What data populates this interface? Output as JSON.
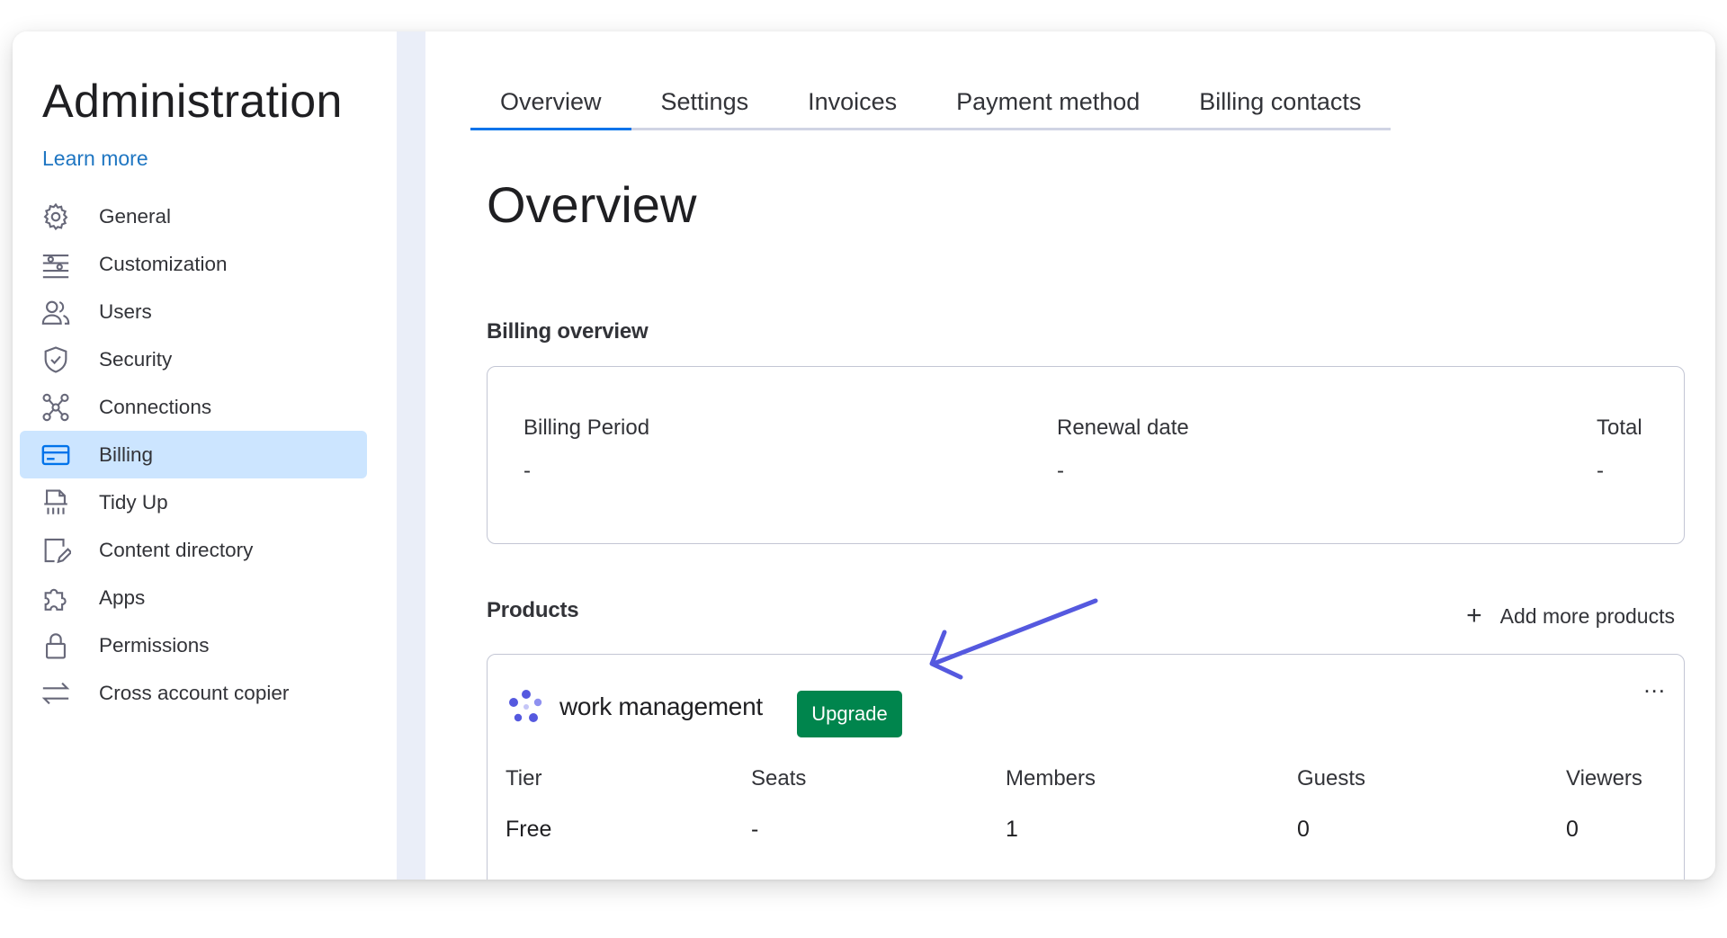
{
  "sidebar": {
    "title": "Administration",
    "learn_more": "Learn more",
    "items": [
      {
        "label": "General",
        "icon": "gear-icon"
      },
      {
        "label": "Customization",
        "icon": "sliders-icon"
      },
      {
        "label": "Users",
        "icon": "users-icon"
      },
      {
        "label": "Security",
        "icon": "shield-icon"
      },
      {
        "label": "Connections",
        "icon": "connections-icon"
      },
      {
        "label": "Billing",
        "icon": "credit-card-icon",
        "active": true
      },
      {
        "label": "Tidy Up",
        "icon": "shredder-icon"
      },
      {
        "label": "Content directory",
        "icon": "content-directory-icon"
      },
      {
        "label": "Apps",
        "icon": "puzzle-icon"
      },
      {
        "label": "Permissions",
        "icon": "lock-icon"
      },
      {
        "label": "Cross account copier",
        "icon": "transfer-arrows-icon"
      }
    ]
  },
  "tabs": [
    {
      "label": "Overview",
      "active": true
    },
    {
      "label": "Settings"
    },
    {
      "label": "Invoices"
    },
    {
      "label": "Payment method"
    },
    {
      "label": "Billing contacts"
    }
  ],
  "page_title": "Overview",
  "billing_overview": {
    "title": "Billing overview",
    "billing_period_label": "Billing Period",
    "billing_period_value": "-",
    "renewal_date_label": "Renewal date",
    "renewal_date_value": "-",
    "total_label": "Total",
    "total_value": "-"
  },
  "products": {
    "title": "Products",
    "add_more": "Add more products",
    "product": {
      "name": "work management",
      "upgrade_label": "Upgrade",
      "more_menu": "...",
      "tier_label": "Tier",
      "tier_value": "Free",
      "seats_label": "Seats",
      "seats_value": "-",
      "members_label": "Members",
      "members_value": "1",
      "guests_label": "Guests",
      "guests_value": "0",
      "viewers_label": "Viewers",
      "viewers_value": "0"
    }
  },
  "colors": {
    "accent": "#0073ea",
    "active_nav_bg": "#cce5ff",
    "upgrade_green": "#00854d",
    "annotation_arrow": "#5559df"
  }
}
